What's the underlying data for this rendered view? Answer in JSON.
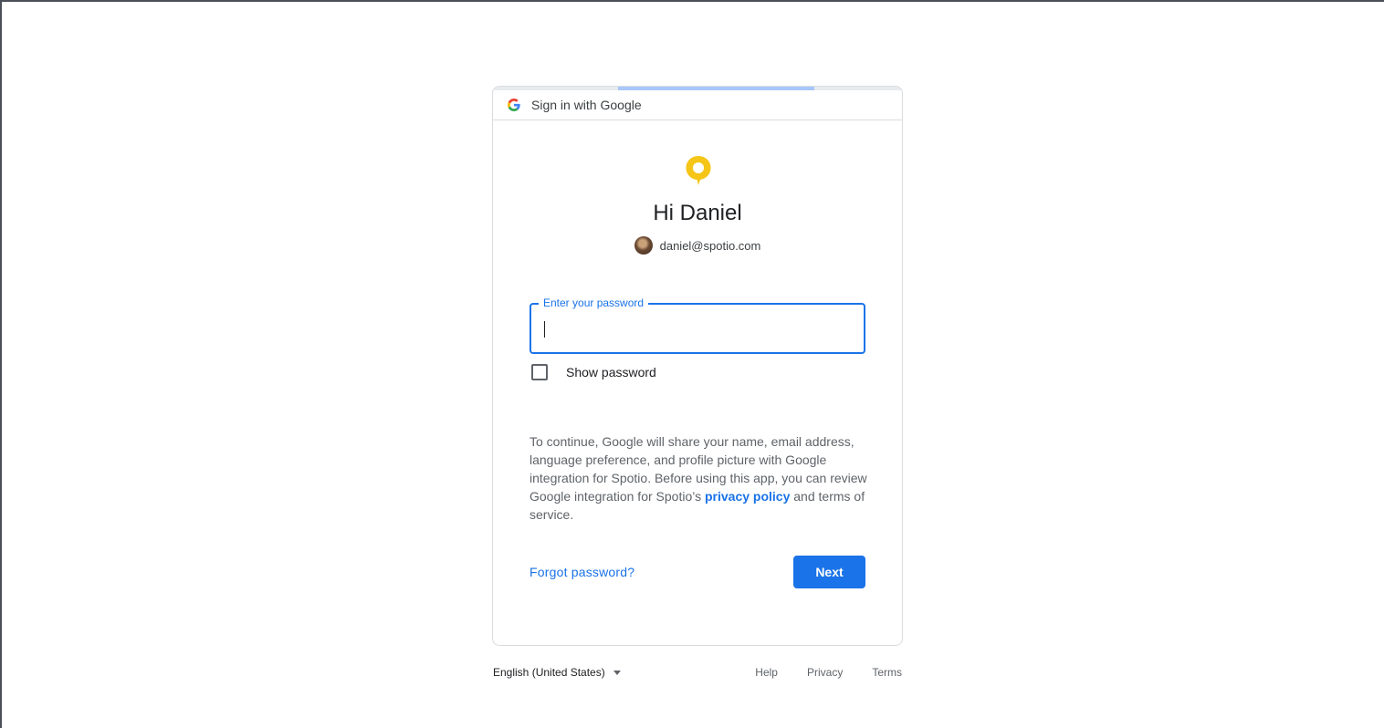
{
  "header": {
    "title": "Sign in with Google",
    "logo_icon": "google-g-icon"
  },
  "progress": {
    "fraction_filled": 0.48,
    "color": "#a8c7fa"
  },
  "app": {
    "logo_icon": "spotio-pin-icon",
    "logo_color": "#f5c518"
  },
  "greeting": "Hi Daniel",
  "account": {
    "email": "daniel@spotio.com"
  },
  "password": {
    "label": "Enter your password",
    "value": ""
  },
  "show_password": {
    "label": "Show password",
    "checked": false
  },
  "disclaimer": {
    "text_before": "To continue, Google will share your name, email address, language preference, and profile picture with Google integration for Spotio. Before using this app, you can review Google integration for Spotio’s ",
    "link_text": "privacy policy",
    "text_after": " and terms of service."
  },
  "actions": {
    "forgot_label": "Forgot password?",
    "next_label": "Next"
  },
  "footer": {
    "language": "English (United States)",
    "links": [
      "Help",
      "Privacy",
      "Terms"
    ]
  },
  "colors": {
    "accent": "#1a73e8",
    "border": "#dadce0"
  }
}
